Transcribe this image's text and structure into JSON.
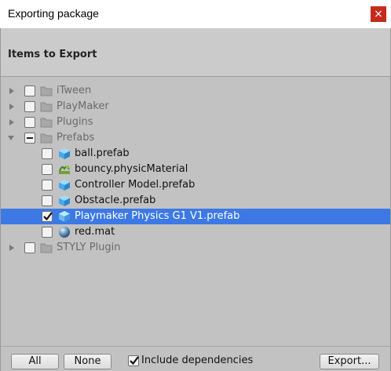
{
  "window": {
    "title": "Exporting package",
    "close_glyph": "×"
  },
  "header": {
    "heading": "Items to Export"
  },
  "tree": {
    "items": [
      {
        "label": "iTween",
        "icon": "folder-icon",
        "expanded": false,
        "checked": false,
        "selected": false
      },
      {
        "label": "PlayMaker",
        "icon": "folder-icon",
        "expanded": false,
        "checked": false,
        "selected": false
      },
      {
        "label": "Plugins",
        "icon": "folder-icon",
        "expanded": false,
        "checked": false,
        "selected": false
      },
      {
        "label": "Prefabs",
        "icon": "folder-icon",
        "expanded": true,
        "checked": "mixed",
        "selected": false
      },
      {
        "label": "ball.prefab",
        "icon": "prefab-cube-icon",
        "checked": false,
        "selected": false
      },
      {
        "label": "bouncy.physicMaterial",
        "icon": "physic-material-icon",
        "checked": false,
        "selected": false
      },
      {
        "label": "Controller  Model.prefab",
        "icon": "prefab-cube-icon",
        "checked": false,
        "selected": false
      },
      {
        "label": "Obstacle.prefab",
        "icon": "prefab-cube-icon",
        "checked": false,
        "selected": false
      },
      {
        "label": "Playmaker  Physics  G1  V1.prefab",
        "icon": "prefab-cube-icon",
        "checked": true,
        "selected": true
      },
      {
        "label": "red.mat",
        "icon": "material-sphere-icon",
        "checked": false,
        "selected": false
      },
      {
        "label": "STYLY  Plugin",
        "icon": "folder-icon",
        "expanded": false,
        "checked": false,
        "selected": false
      }
    ]
  },
  "footer": {
    "all_label": "All",
    "none_label": "None",
    "include_dependencies_label": "Include dependencies",
    "include_dependencies_checked": true,
    "export_label": "Export..."
  },
  "colors": {
    "selection": "#3c79e5",
    "panel_bg": "#c2c2c2",
    "close_button": "#c42b1c"
  }
}
